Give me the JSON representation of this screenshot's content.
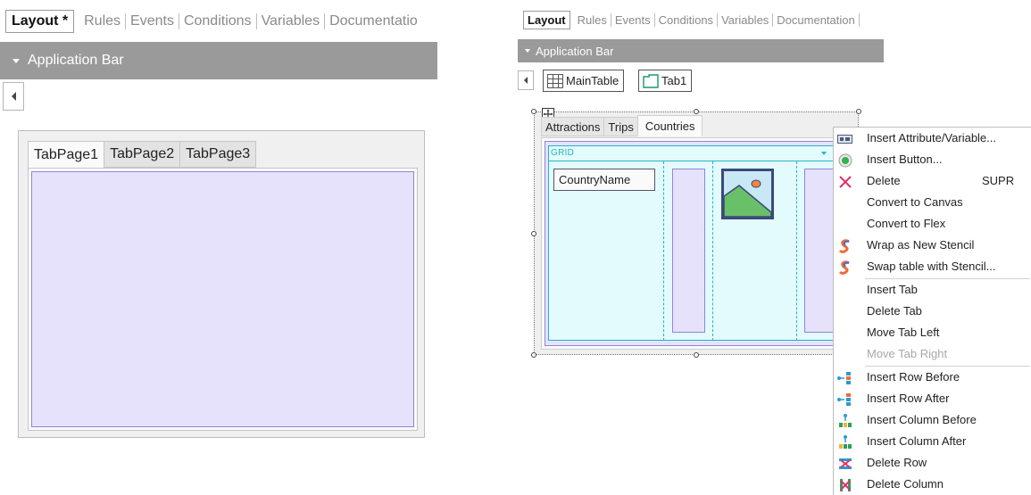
{
  "left": {
    "tabs": {
      "active": "Layout *",
      "others": [
        "Rules",
        "Events",
        "Conditions",
        "Variables",
        "Documentatio"
      ]
    },
    "app_bar_label": "Application Bar",
    "tab_pages": [
      "TabPage1",
      "TabPage2",
      "TabPage3"
    ]
  },
  "right": {
    "tabs": {
      "active": "Layout",
      "others": [
        "Rules",
        "Events",
        "Conditions",
        "Variables",
        "Documentation"
      ]
    },
    "app_bar_label": "Application Bar",
    "breadcrumb": {
      "main_table": "MainTable",
      "tab": "Tab1"
    },
    "tab_pages": [
      "Attractions",
      "Trips",
      "Countries"
    ],
    "grid_label": "GRID",
    "country_field": "CountryName",
    "context_menu": {
      "items": [
        {
          "label": "Insert Attribute/Variable...",
          "icon": "attribute-variable-icon"
        },
        {
          "label": "Insert Button...",
          "icon": "button-icon"
        },
        {
          "label": "Delete",
          "shortcut": "SUPR",
          "icon": "delete-x-icon"
        },
        {
          "label": "Convert to Canvas"
        },
        {
          "label": "Convert to Flex"
        },
        {
          "label": "Wrap as New Stencil",
          "icon": "stencil-icon"
        },
        {
          "label": "Swap table with Stencil...",
          "icon": "stencil-icon"
        },
        {
          "label": "Insert Tab"
        },
        {
          "label": "Delete Tab"
        },
        {
          "label": "Move Tab Left"
        },
        {
          "label": "Move Tab Right",
          "disabled": true
        },
        {
          "label": "Insert Row Before",
          "icon": "insert-row-icon"
        },
        {
          "label": "Insert Row After",
          "icon": "insert-row-icon"
        },
        {
          "label": "Insert Column Before",
          "icon": "insert-column-icon"
        },
        {
          "label": "Insert Column After",
          "icon": "insert-column-icon"
        },
        {
          "label": "Delete Row",
          "icon": "delete-row-icon"
        },
        {
          "label": "Delete Column",
          "icon": "delete-column-icon"
        }
      ]
    }
  },
  "colors": {
    "app_bar": "#9a9a9a",
    "tab_page_fill": "#e6e2fb",
    "tab_page_border": "#8d86d8",
    "grid_fill": "#e3fbfd",
    "grid_border": "#27b4c5"
  }
}
